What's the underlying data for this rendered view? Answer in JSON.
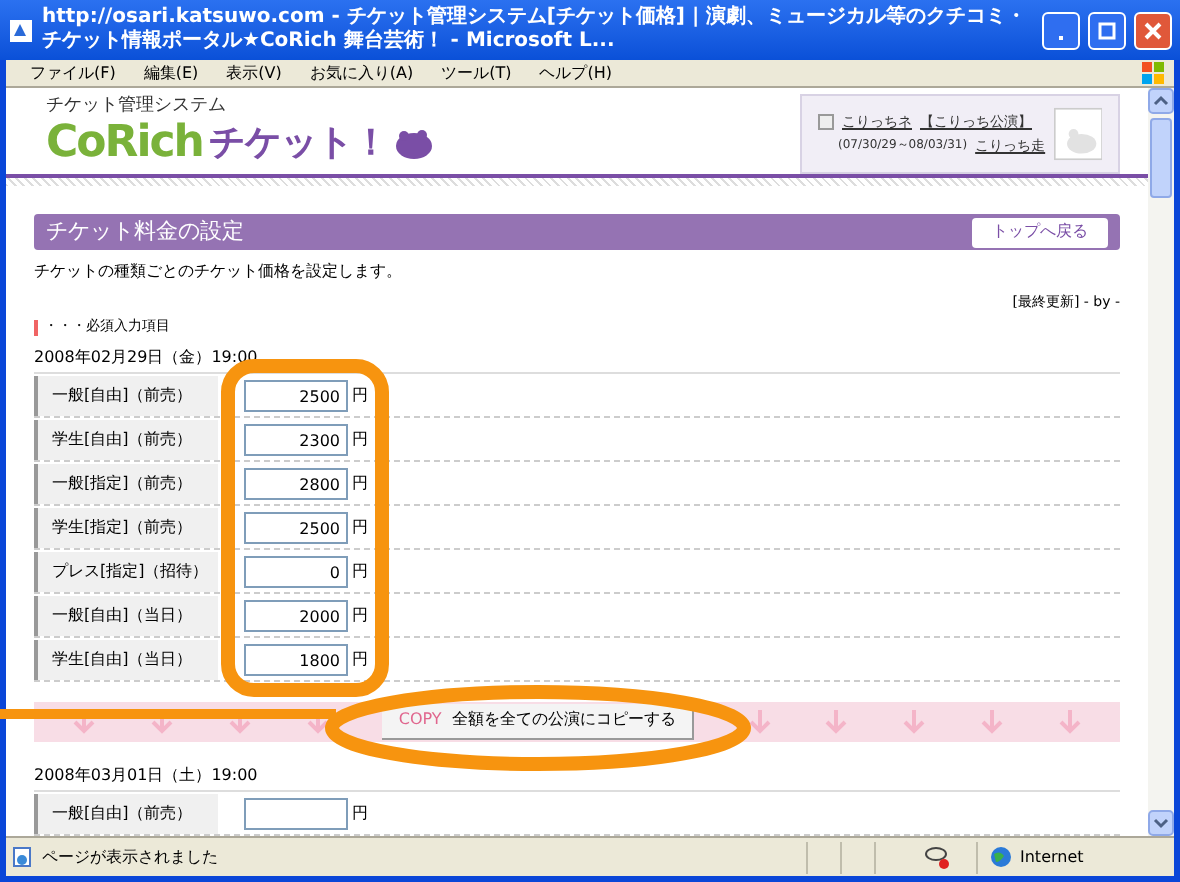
{
  "window": {
    "title": "http://osari.katsuwo.com - チケット管理システム[チケット価格] | 演劇、ミュージカル等のクチコミ・チケット情報ポータル★CoRich 舞台芸術！ - Microsoft L..."
  },
  "menu": [
    "ファイル(F)",
    "編集(E)",
    "表示(V)",
    "お気に入り(A)",
    "ツール(T)",
    "ヘルプ(H)"
  ],
  "header": {
    "system_name": "チケット管理システム",
    "logo_brand": "CoRich",
    "logo_suffix": "チケット！",
    "links": [
      "こりっちネ",
      "【こりっち公演】"
    ],
    "period": "(07/30/29～08/03/31)",
    "period_link": "こりっち走"
  },
  "section": {
    "title": "チケット料金の設定",
    "back_button": "トップへ戻る"
  },
  "description": "チケットの種類ごとのチケット価格を設定します。",
  "last_updated": "[最終更新] - by -",
  "required_note": "・・・必須入力項目",
  "performances": [
    {
      "datetime": "2008年02月29日（金）19:00",
      "rows": [
        {
          "label": "一般[自由]（前売）",
          "value": "2500",
          "unit": "円"
        },
        {
          "label": "学生[自由]（前売）",
          "value": "2300",
          "unit": "円"
        },
        {
          "label": "一般[指定]（前売）",
          "value": "2800",
          "unit": "円"
        },
        {
          "label": "学生[指定]（前売）",
          "value": "2500",
          "unit": "円"
        },
        {
          "label": "プレス[指定]（招待）",
          "value": "0",
          "unit": "円"
        },
        {
          "label": "一般[自由]（当日）",
          "value": "2000",
          "unit": "円"
        },
        {
          "label": "学生[自由]（当日）",
          "value": "1800",
          "unit": "円"
        }
      ]
    },
    {
      "datetime": "2008年03月01日（土）19:00",
      "rows": [
        {
          "label": "一般[自由]（前売）",
          "value": "",
          "unit": "円"
        }
      ]
    }
  ],
  "copy_button": {
    "prefix": "COPY",
    "label": "全額を全ての公演にコピーする"
  },
  "status_bar": {
    "text": "ページが表示されました",
    "zone": "Internet"
  }
}
